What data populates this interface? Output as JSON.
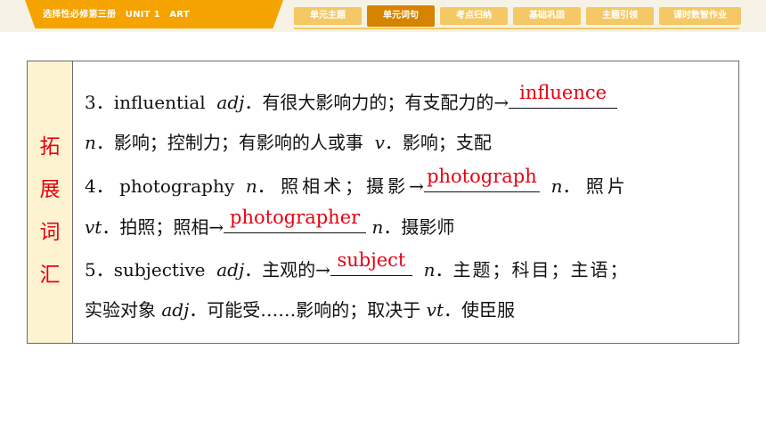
{
  "header": {
    "breadcrumb": "选择性必修第三册　UNIT 1　ART",
    "tabs": [
      "单元主题",
      "单元词句",
      "考点归纳",
      "基础巩固",
      "主题引领",
      "课时数智作业"
    ],
    "active_tab": "单元词句"
  },
  "section": {
    "side_label": [
      "拓",
      "展",
      "词",
      "汇"
    ]
  },
  "entries": {
    "e3": {
      "num": "3",
      "word": "influential",
      "pos1": "adj",
      "def1": "有很大影响力的；有支配力的",
      "answer": "influence",
      "pos2": "n",
      "def2": "影响；控制力；有影响的人或事",
      "pos3": "v",
      "def3": "影响；支配"
    },
    "e4": {
      "num": "4",
      "word": "photography",
      "pos1": "n",
      "def1": "照相术；摄影",
      "answer1": "photograph",
      "pos2": "n",
      "def2": "照片",
      "pos3": "vt",
      "def3": "拍照；照相",
      "answer2": "photographer",
      "pos4": "n",
      "def4": "摄影师"
    },
    "e5": {
      "num": "5",
      "word": "subjective",
      "pos1": "adj",
      "def1": "主观的",
      "answer": "subject",
      "pos2": "n",
      "def2a": "主题；科目；主语；",
      "def2b": "实验对象",
      "pos3": "adj",
      "def3": "可能受……影响的；取决于",
      "pos4": "vt",
      "def4": "使臣服"
    }
  },
  "colors": {
    "accent": "#f4a300",
    "tab": "#f4c865",
    "tab_active": "#d58400",
    "answer": "#e60012",
    "side_bg": "#fdf3d0"
  }
}
